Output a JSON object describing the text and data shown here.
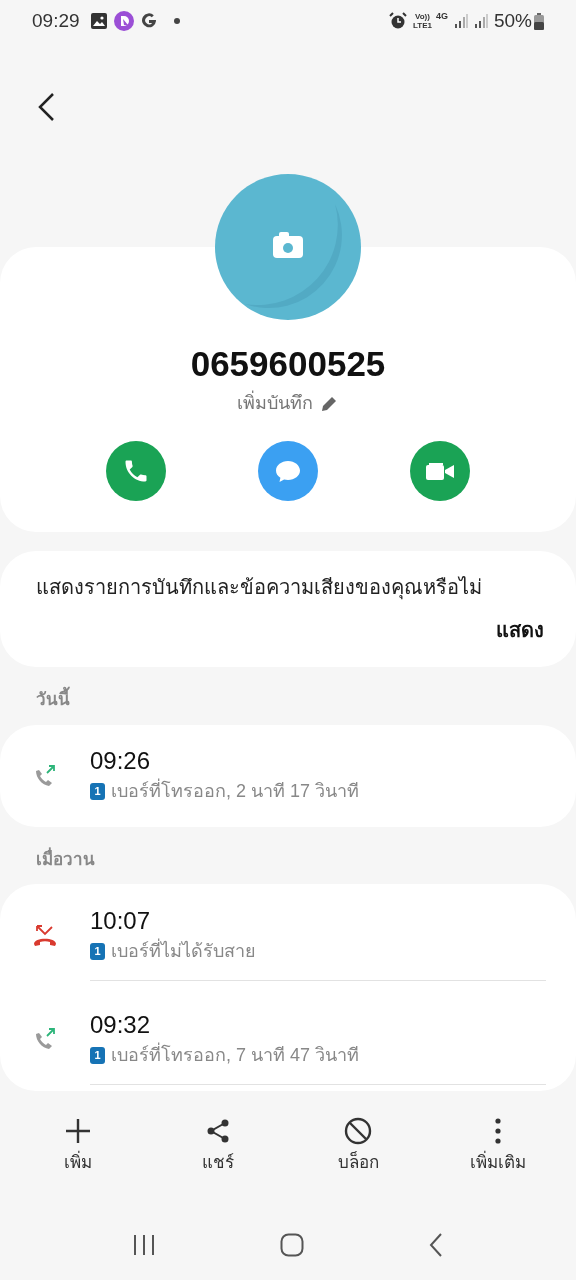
{
  "status_bar": {
    "time": "09:29",
    "volte": "Vo))",
    "lte": "LTE1",
    "network": "4G",
    "battery": "50%"
  },
  "contact": {
    "number": "0659600525",
    "note_action": "เพิ่มบันทึก"
  },
  "prompt": {
    "text": "แสดงรายการบันทึกและข้อความเสียงของคุณหรือไม่",
    "action": "แสดง"
  },
  "call_groups": [
    {
      "header": "วันนี้",
      "calls": [
        {
          "kind": "outgoing",
          "time": "09:26",
          "sim": "1",
          "detail": "เบอร์ที่โทรออก, 2 นาที 17 วินาที"
        }
      ]
    },
    {
      "header": "เมื่อวาน",
      "calls": [
        {
          "kind": "missed",
          "time": "10:07",
          "sim": "1",
          "detail": "เบอร์ที่ไม่ได้รับสาย"
        },
        {
          "kind": "outgoing",
          "time": "09:32",
          "sim": "1",
          "detail": "เบอร์ที่โทรออก, 7 นาที 47 วินาที"
        }
      ]
    }
  ],
  "bottom_actions": [
    {
      "kind": "add",
      "label": "เพิ่ม"
    },
    {
      "kind": "share",
      "label": "แชร์"
    },
    {
      "kind": "block",
      "label": "บล็อก"
    },
    {
      "kind": "more",
      "label": "เพิ่มเติม"
    }
  ]
}
